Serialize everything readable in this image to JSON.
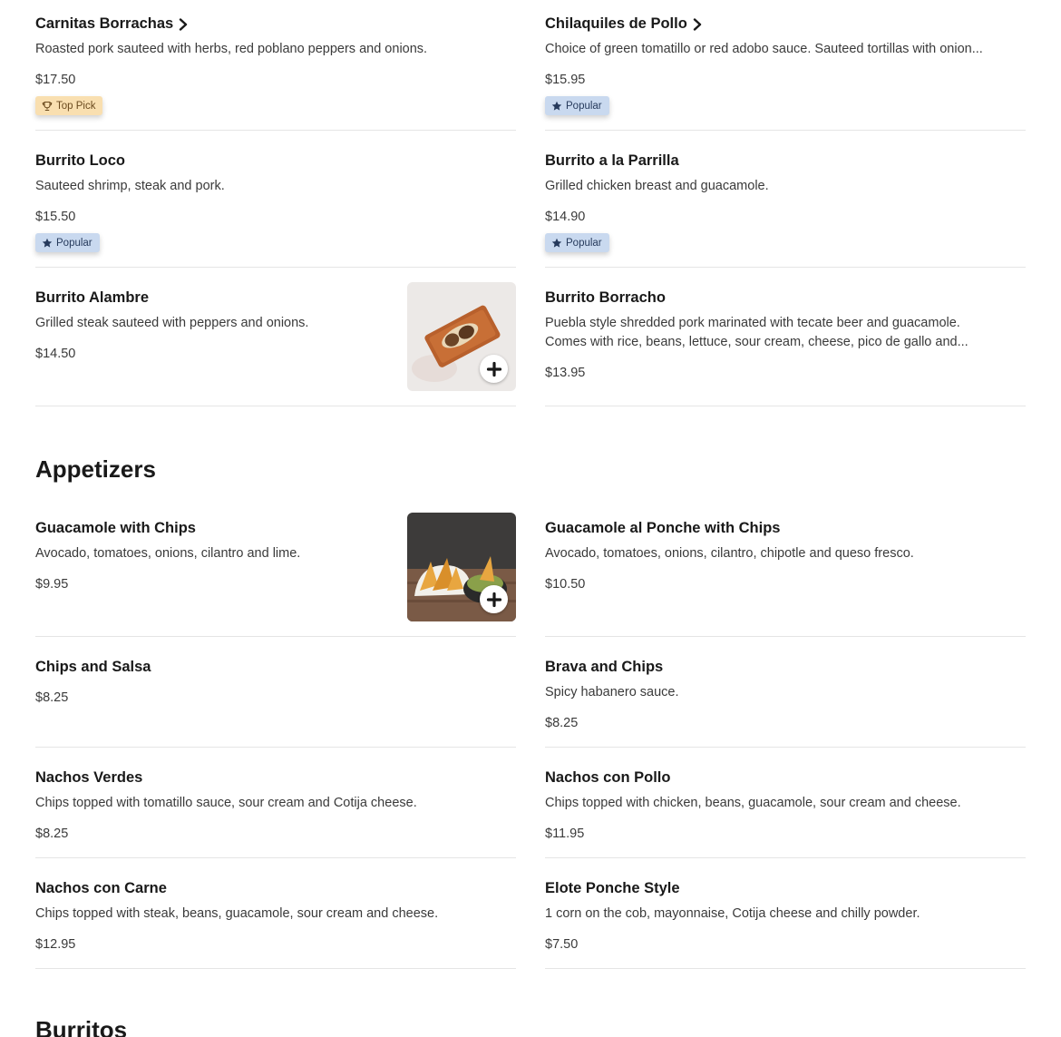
{
  "colors": {
    "text": "#191919",
    "muted": "#3a3a3a",
    "divider": "#e5e5e5",
    "top_pick_bg": "#f9dfb0",
    "popular_bg": "#c9d9ef"
  },
  "items_top": {
    "carnitas": {
      "name": "Carnitas Borrachas",
      "desc": "Roasted pork sauteed with herbs, red poblano peppers and onions.",
      "price": "$17.50",
      "badge": "Top Pick",
      "badge_icon": "trophy-icon"
    },
    "chilaquiles": {
      "name": "Chilaquiles de Pollo",
      "desc": "Choice of green tomatillo or red adobo sauce. Sauteed tortillas with onion...",
      "price": "$15.95",
      "badge": "Popular",
      "badge_icon": "star-icon"
    },
    "burrito_loco": {
      "name": "Burrito Loco",
      "desc": "Sauteed shrimp, steak and pork.",
      "price": "$15.50",
      "badge": "Popular",
      "badge_icon": "star-icon"
    },
    "burrito_parrilla": {
      "name": "Burrito a la Parrilla",
      "desc": "Grilled chicken breast and guacamole.",
      "price": "$14.90",
      "badge": "Popular",
      "badge_icon": "star-icon"
    },
    "burrito_alambre": {
      "name": "Burrito Alambre",
      "desc": "Grilled steak sauteed with peppers and onions.",
      "price": "$14.50"
    },
    "burrito_borracho": {
      "name": "Burrito Borracho",
      "desc_line1": "Puebla style shredded pork marinated with tecate beer and guacamole.",
      "desc_line2": "Comes with rice, beans, lettuce, sour cream, cheese, pico de gallo and...",
      "price": "$13.95"
    }
  },
  "appetizers": {
    "title": "Appetizers",
    "guacamole": {
      "name": "Guacamole with Chips",
      "desc": "Avocado, tomatoes, onions, cilantro and lime.",
      "price": "$9.95"
    },
    "guacamole_ponche": {
      "name": "Guacamole al Ponche with Chips",
      "desc": "Avocado, tomatoes, onions, cilantro, chipotle and queso fresco.",
      "price": "$10.50"
    },
    "chips_salsa": {
      "name": "Chips and Salsa",
      "price": "$8.25"
    },
    "brava": {
      "name": "Brava and Chips",
      "desc": "Spicy habanero sauce.",
      "price": "$8.25"
    },
    "nachos_verdes": {
      "name": "Nachos Verdes",
      "desc": "Chips topped with tomatillo sauce, sour cream and Cotija cheese.",
      "price": "$8.25"
    },
    "nachos_pollo": {
      "name": "Nachos con Pollo",
      "desc": "Chips topped with chicken, beans, guacamole, sour cream and cheese.",
      "price": "$11.95"
    },
    "nachos_carne": {
      "name": "Nachos con Carne",
      "desc": "Chips topped with steak, beans, guacamole, sour cream and cheese.",
      "price": "$12.95"
    },
    "elote": {
      "name": "Elote Ponche Style",
      "desc": "1 corn on the cob, mayonnaise, Cotija cheese and chilly powder.",
      "price": "$7.50"
    }
  },
  "burritos": {
    "title": "Burritos"
  }
}
